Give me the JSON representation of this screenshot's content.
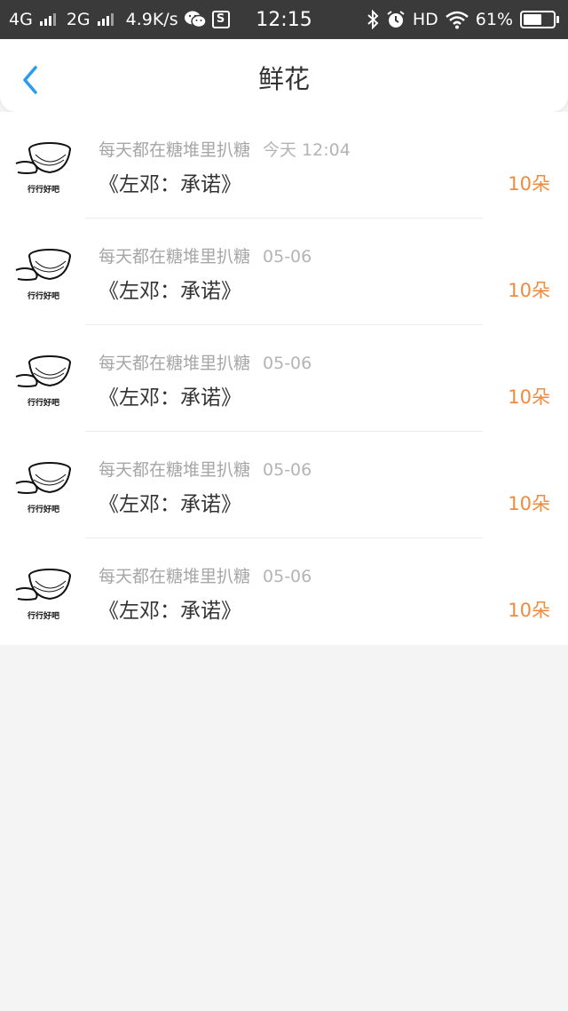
{
  "status_bar": {
    "network1": "4G",
    "network2": "2G",
    "speed": "4.9K/s",
    "time": "12:15",
    "hd": "HD",
    "battery_text": "61%",
    "battery_level": 0.61,
    "icons": [
      "signal-bars-icon",
      "wechat-icon",
      "s-app-icon",
      "bluetooth-icon",
      "alarm-icon",
      "wifi-icon",
      "battery-icon"
    ]
  },
  "header": {
    "title": "鲜花",
    "back_icon": "chevron-left-icon"
  },
  "colors": {
    "accent_blue": "#2a9cf0",
    "amount_orange": "#f08a3c",
    "status_bar_bg": "#3a3a3a"
  },
  "gifts": [
    {
      "avatar_caption": "行行好吧",
      "user": "每天都在糖堆里扒糖",
      "date": "今天 12:04",
      "title": "《左邓：承诺》",
      "amount": "10朵"
    },
    {
      "avatar_caption": "行行好吧",
      "user": "每天都在糖堆里扒糖",
      "date": "05-06",
      "title": "《左邓：承诺》",
      "amount": "10朵"
    },
    {
      "avatar_caption": "行行好吧",
      "user": "每天都在糖堆里扒糖",
      "date": "05-06",
      "title": "《左邓：承诺》",
      "amount": "10朵"
    },
    {
      "avatar_caption": "行行好吧",
      "user": "每天都在糖堆里扒糖",
      "date": "05-06",
      "title": "《左邓：承诺》",
      "amount": "10朵"
    },
    {
      "avatar_caption": "行行好吧",
      "user": "每天都在糖堆里扒糖",
      "date": "05-06",
      "title": "《左邓：承诺》",
      "amount": "10朵"
    }
  ]
}
